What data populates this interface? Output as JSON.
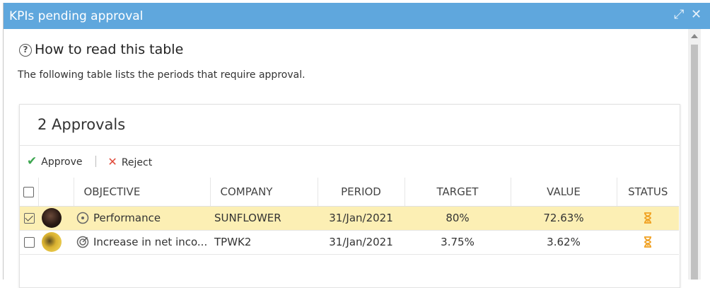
{
  "window": {
    "title": "KPIs pending approval",
    "expand_icon": "⤢",
    "close_icon": "✕"
  },
  "help": {
    "heading": "How to read this table",
    "icon_glyph": "?",
    "text": "The following table lists the periods that require approval."
  },
  "panel": {
    "title": "2 Approvals",
    "approve_label": "Approve",
    "reject_label": "Reject"
  },
  "table": {
    "headers": [
      "OBJECTIVE",
      "COMPANY",
      "PERIOD",
      "TARGET",
      "VALUE",
      "STATUS"
    ],
    "rows": [
      {
        "selected": true,
        "objective": "Performance",
        "objective_icon": "target-circle-icon",
        "company": "SUNFLOWER",
        "period": "31/Jan/2021",
        "target": "80%",
        "value": "72.63%",
        "status_icon": "hourglass-icon"
      },
      {
        "selected": false,
        "objective": "Increase in net inco...",
        "objective_icon": "bullseye-icon",
        "company": "TPWK2",
        "period": "31/Jan/2021",
        "target": "3.75%",
        "value": "3.62%",
        "status_icon": "hourglass-icon"
      }
    ]
  },
  "colors": {
    "titlebar": "#5fa7dd",
    "selected_row": "#fcefb4",
    "approve_green": "#3da650",
    "reject_red": "#e04a3a",
    "hourglass_orange": "#f0a020"
  }
}
